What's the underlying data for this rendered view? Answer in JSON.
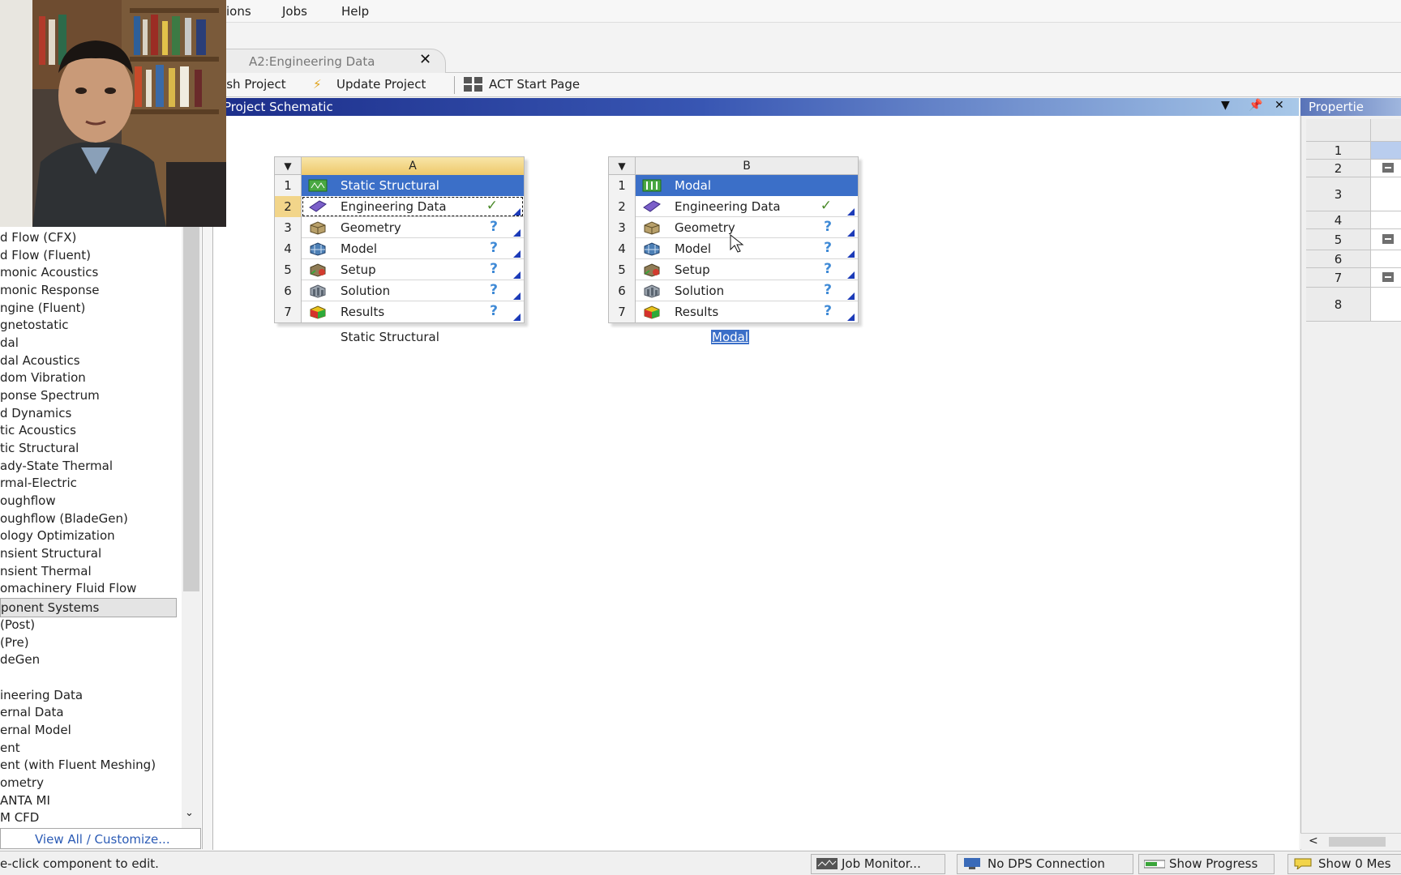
{
  "menubar": {
    "items": [
      "ions",
      "Jobs",
      "Help"
    ]
  },
  "tabs": {
    "active_tab": "A2:Engineering Data"
  },
  "toolbar": {
    "refresh_label": "esh Project",
    "update_label": "Update Project",
    "act_label": "ACT Start Page"
  },
  "schematic": {
    "title": "Project Schematic"
  },
  "systems": [
    {
      "column": "A",
      "label": "Static Structural",
      "rows": [
        {
          "num": "1",
          "name": "Static Structural",
          "status": "",
          "icon": "static-structural-icon"
        },
        {
          "num": "2",
          "name": "Engineering Data",
          "status": "✓",
          "icon": "engineering-data-icon"
        },
        {
          "num": "3",
          "name": "Geometry",
          "status": "?",
          "icon": "geometry-icon"
        },
        {
          "num": "4",
          "name": "Model",
          "status": "?",
          "icon": "model-icon"
        },
        {
          "num": "5",
          "name": "Setup",
          "status": "?",
          "icon": "setup-icon"
        },
        {
          "num": "6",
          "name": "Solution",
          "status": "?",
          "icon": "solution-icon"
        },
        {
          "num": "7",
          "name": "Results",
          "status": "?",
          "icon": "results-icon"
        }
      ]
    },
    {
      "column": "B",
      "label": "Modal",
      "rows": [
        {
          "num": "1",
          "name": "Modal",
          "status": "",
          "icon": "modal-icon"
        },
        {
          "num": "2",
          "name": "Engineering Data",
          "status": "✓",
          "icon": "engineering-data-icon"
        },
        {
          "num": "3",
          "name": "Geometry",
          "status": "?",
          "icon": "geometry-icon"
        },
        {
          "num": "4",
          "name": "Model",
          "status": "?",
          "icon": "model-icon"
        },
        {
          "num": "5",
          "name": "Setup",
          "status": "?",
          "icon": "setup-icon"
        },
        {
          "num": "6",
          "name": "Solution",
          "status": "?",
          "icon": "solution-icon"
        },
        {
          "num": "7",
          "name": "Results",
          "status": "?",
          "icon": "results-icon"
        }
      ]
    }
  ],
  "toolbox": {
    "analysis_items": [
      "d Flow (CFX)",
      "d Flow (Fluent)",
      "monic Acoustics",
      "monic Response",
      "ngine (Fluent)",
      "gnetostatic",
      "dal",
      "dal Acoustics",
      "dom Vibration",
      "ponse Spectrum",
      "d Dynamics",
      "tic Acoustics",
      "tic Structural",
      "ady-State Thermal",
      "rmal-Electric",
      "oughflow",
      "oughflow (BladeGen)",
      "ology Optimization",
      "nsient Structural",
      "nsient Thermal",
      "omachinery Fluid Flow"
    ],
    "group_header": "ponent Systems",
    "component_items": [
      "(Post)",
      "(Pre)",
      "deGen",
      "",
      "ineering Data",
      "ernal Data",
      "ernal Model",
      "ent",
      "ent (with Fluent Meshing)",
      "ometry",
      "ANTA MI",
      "M CFD"
    ],
    "view_all": "View All / Customize..."
  },
  "properties": {
    "title": "Propertie",
    "rows": [
      "",
      "1",
      "2",
      "3",
      "4",
      "5",
      "6",
      "7",
      "8"
    ]
  },
  "statusbar": {
    "message": "e-click component to edit.",
    "job_monitor": "Job Monitor...",
    "dps": "No DPS Connection",
    "progress": "Show Progress",
    "messages": "Show 0 Mes"
  },
  "colors": {
    "selected_row": "#3b6fc8",
    "header_gradient_start": "#1c2e8a",
    "status_question": "#3f8ad6",
    "status_ok": "#4a8a2a"
  }
}
